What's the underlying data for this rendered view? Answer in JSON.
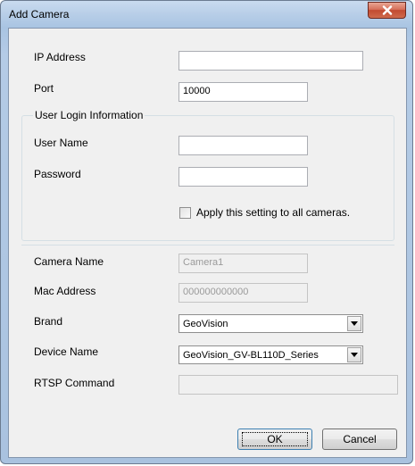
{
  "window": {
    "title": "Add Camera"
  },
  "fields": {
    "ip_address": {
      "label": "IP Address",
      "value": ""
    },
    "port": {
      "label": "Port",
      "value": "10000"
    },
    "user_login_group": "User Login Information",
    "user_name": {
      "label": "User Name",
      "value": ""
    },
    "password": {
      "label": "Password",
      "value": ""
    },
    "apply_all": {
      "label": "Apply this setting to all cameras.",
      "checked": false
    },
    "camera_name": {
      "label": "Camera Name",
      "value": "Camera1"
    },
    "mac_address": {
      "label": "Mac Address",
      "value": "000000000000"
    },
    "brand": {
      "label": "Brand",
      "selected": "GeoVision"
    },
    "device_name": {
      "label": "Device Name",
      "selected": "GeoVision_GV-BL110D_Series"
    },
    "rtsp_command": {
      "label": "RTSP Command",
      "value": ""
    }
  },
  "buttons": {
    "ok": "OK",
    "cancel": "Cancel"
  },
  "icons": {
    "close": "close-icon",
    "dropdown": "chevron-down-icon"
  },
  "colors": {
    "close_button": "#c94a32",
    "title_bar": "#b9cfe8",
    "dialog_bg": "#f0f0f0"
  }
}
